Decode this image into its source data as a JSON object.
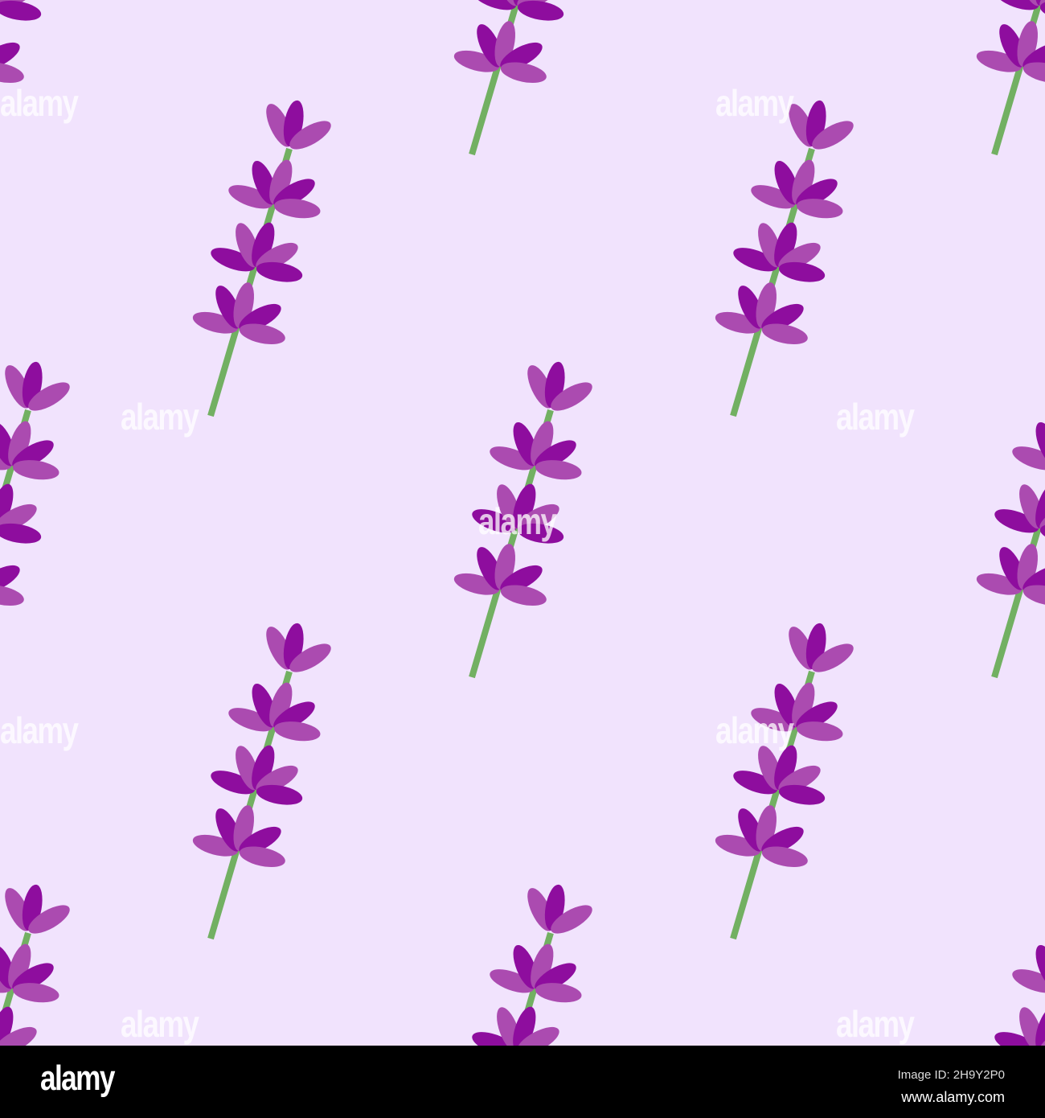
{
  "colors": {
    "background": "#f1e3fd",
    "petal_dark": "#8e0d9e",
    "petal_light": "#ab4bb0",
    "stem": "#72b062"
  },
  "watermark": "alamy",
  "footer": {
    "logo": "alamy",
    "image_id": "Image ID: 2H9Y2P0",
    "url": "www.alamy.com"
  }
}
